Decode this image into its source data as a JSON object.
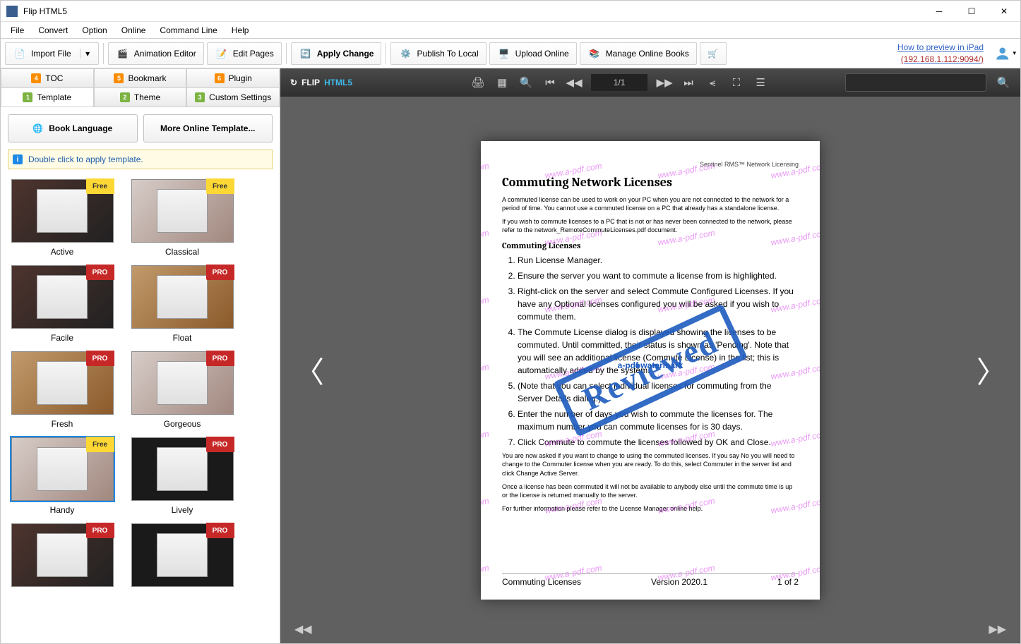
{
  "app": {
    "title": "Flip HTML5"
  },
  "menu": [
    "File",
    "Convert",
    "Option",
    "Online",
    "Command Line",
    "Help"
  ],
  "toolbar": {
    "import": "Import File",
    "anim": "Animation Editor",
    "edit_pages": "Edit Pages",
    "apply": "Apply Change",
    "publish_local": "Publish To Local",
    "upload_online": "Upload Online",
    "manage_books": "Manage Online Books",
    "link1": "How to preview in iPad",
    "link2": "(192.168.1.112:9094/)"
  },
  "tabs_top": [
    {
      "n": "4",
      "label": "TOC"
    },
    {
      "n": "5",
      "label": "Bookmark"
    },
    {
      "n": "6",
      "label": "Plugin"
    }
  ],
  "tabs_bottom": [
    {
      "n": "1",
      "label": "Template",
      "active": true
    },
    {
      "n": "2",
      "label": "Theme"
    },
    {
      "n": "3",
      "label": "Custom Settings"
    }
  ],
  "left_buttons": {
    "lang": "Book Language",
    "more": "More Online Template..."
  },
  "hint": "Double click to apply template.",
  "templates": [
    {
      "name": "Active",
      "badge": "Free",
      "cls": "dark"
    },
    {
      "name": "Classical",
      "badge": "Free",
      "cls": "light"
    },
    {
      "name": "Facile",
      "badge": "PRO",
      "cls": "dark"
    },
    {
      "name": "Float",
      "badge": "PRO",
      "cls": "wood"
    },
    {
      "name": "Fresh",
      "badge": "PRO",
      "cls": "wood"
    },
    {
      "name": "Gorgeous",
      "badge": "PRO",
      "cls": "light"
    },
    {
      "name": "Handy",
      "badge": "Free",
      "cls": "light",
      "selected": true
    },
    {
      "name": "Lively",
      "badge": "PRO",
      "cls": "black"
    },
    {
      "name": "",
      "badge": "PRO",
      "cls": "dark"
    },
    {
      "name": "",
      "badge": "PRO",
      "cls": "black"
    }
  ],
  "preview": {
    "brand1": "FLIP",
    "brand2": "HTML5",
    "page_indicator": "1/1",
    "doc_header": "Sentinel RMS™ Network Licensing",
    "doc_h1": "Commuting Network Licenses",
    "doc_p1": "A commuted license can be used to work on your PC when you are not connected to the network for a period of time. You cannot use a commuted license on a PC that already has a standalone license.",
    "doc_p2": "If you wish to commute licenses to a PC that is not or has never been connected to the network, please refer to the network_RemoteCommuteLicenses.pdf document.",
    "doc_h2": "Commuting Licenses",
    "steps": [
      "Run License Manager.",
      "Ensure the server you want to commute a license from is highlighted.",
      "Right-click on the server and select Commute Configured Licenses. If you have any Optional licenses configured you will be asked if you wish to commute them.",
      "The Commute License dialog is displayed showing the licenses to be commuted. Until committed, their status is shown as 'Pending'. Note that you will see an additional license (Commute License) in the list; this is automatically added by the system.",
      "(Note that you can select individual licenses for commuting from the Server Details dialog.)",
      "Enter the number of days you wish to commute the licenses for. The maximum number you can commute licenses for is 30 days.",
      "Click Commute to commute the licenses followed by OK and Close."
    ],
    "doc_p3": "You are now asked if you want to change to using the commuted licenses. If you say No you will need to change to the Commuter license when you are ready. To do this, select Commuter in the server list and click Change Active Server.",
    "doc_p4": "Once a license has been commuted it will not be available to anybody else until the commute time is up or the license is returned manually to the server.",
    "doc_p5": "For further information please refer to the License Manager online help.",
    "foot_left": "Commuting Licenses",
    "foot_mid": "Version 2020.1",
    "foot_right": "1 of 2",
    "stamp": "Reviewed",
    "wm_center": "a-pdf watermark",
    "wm_url": "www.a-pdf.com"
  }
}
